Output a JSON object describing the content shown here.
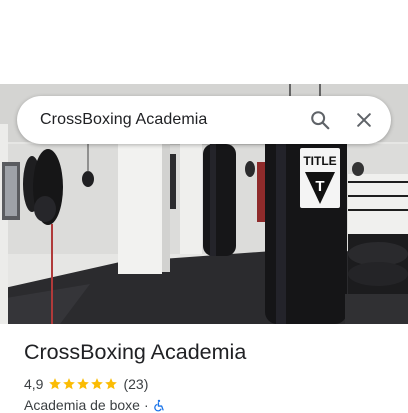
{
  "search": {
    "query": "CrossBoxing Academia",
    "search_icon": "search-icon",
    "close_icon": "close-icon"
  },
  "place": {
    "name": "CrossBoxing Academia",
    "rating": "4,9",
    "stars": 5,
    "review_count": "(23)",
    "category": "Academia de boxe",
    "separator": "·",
    "category_icon": "wheelchair-accessible-icon"
  },
  "photo": {
    "bag_brand": "TITLE",
    "bag_logo_letter": "T"
  },
  "colors": {
    "star": "#fbbc04",
    "accessible_icon": "#1a73e8",
    "text_primary": "#202124",
    "text_secondary": "#3c4043"
  }
}
